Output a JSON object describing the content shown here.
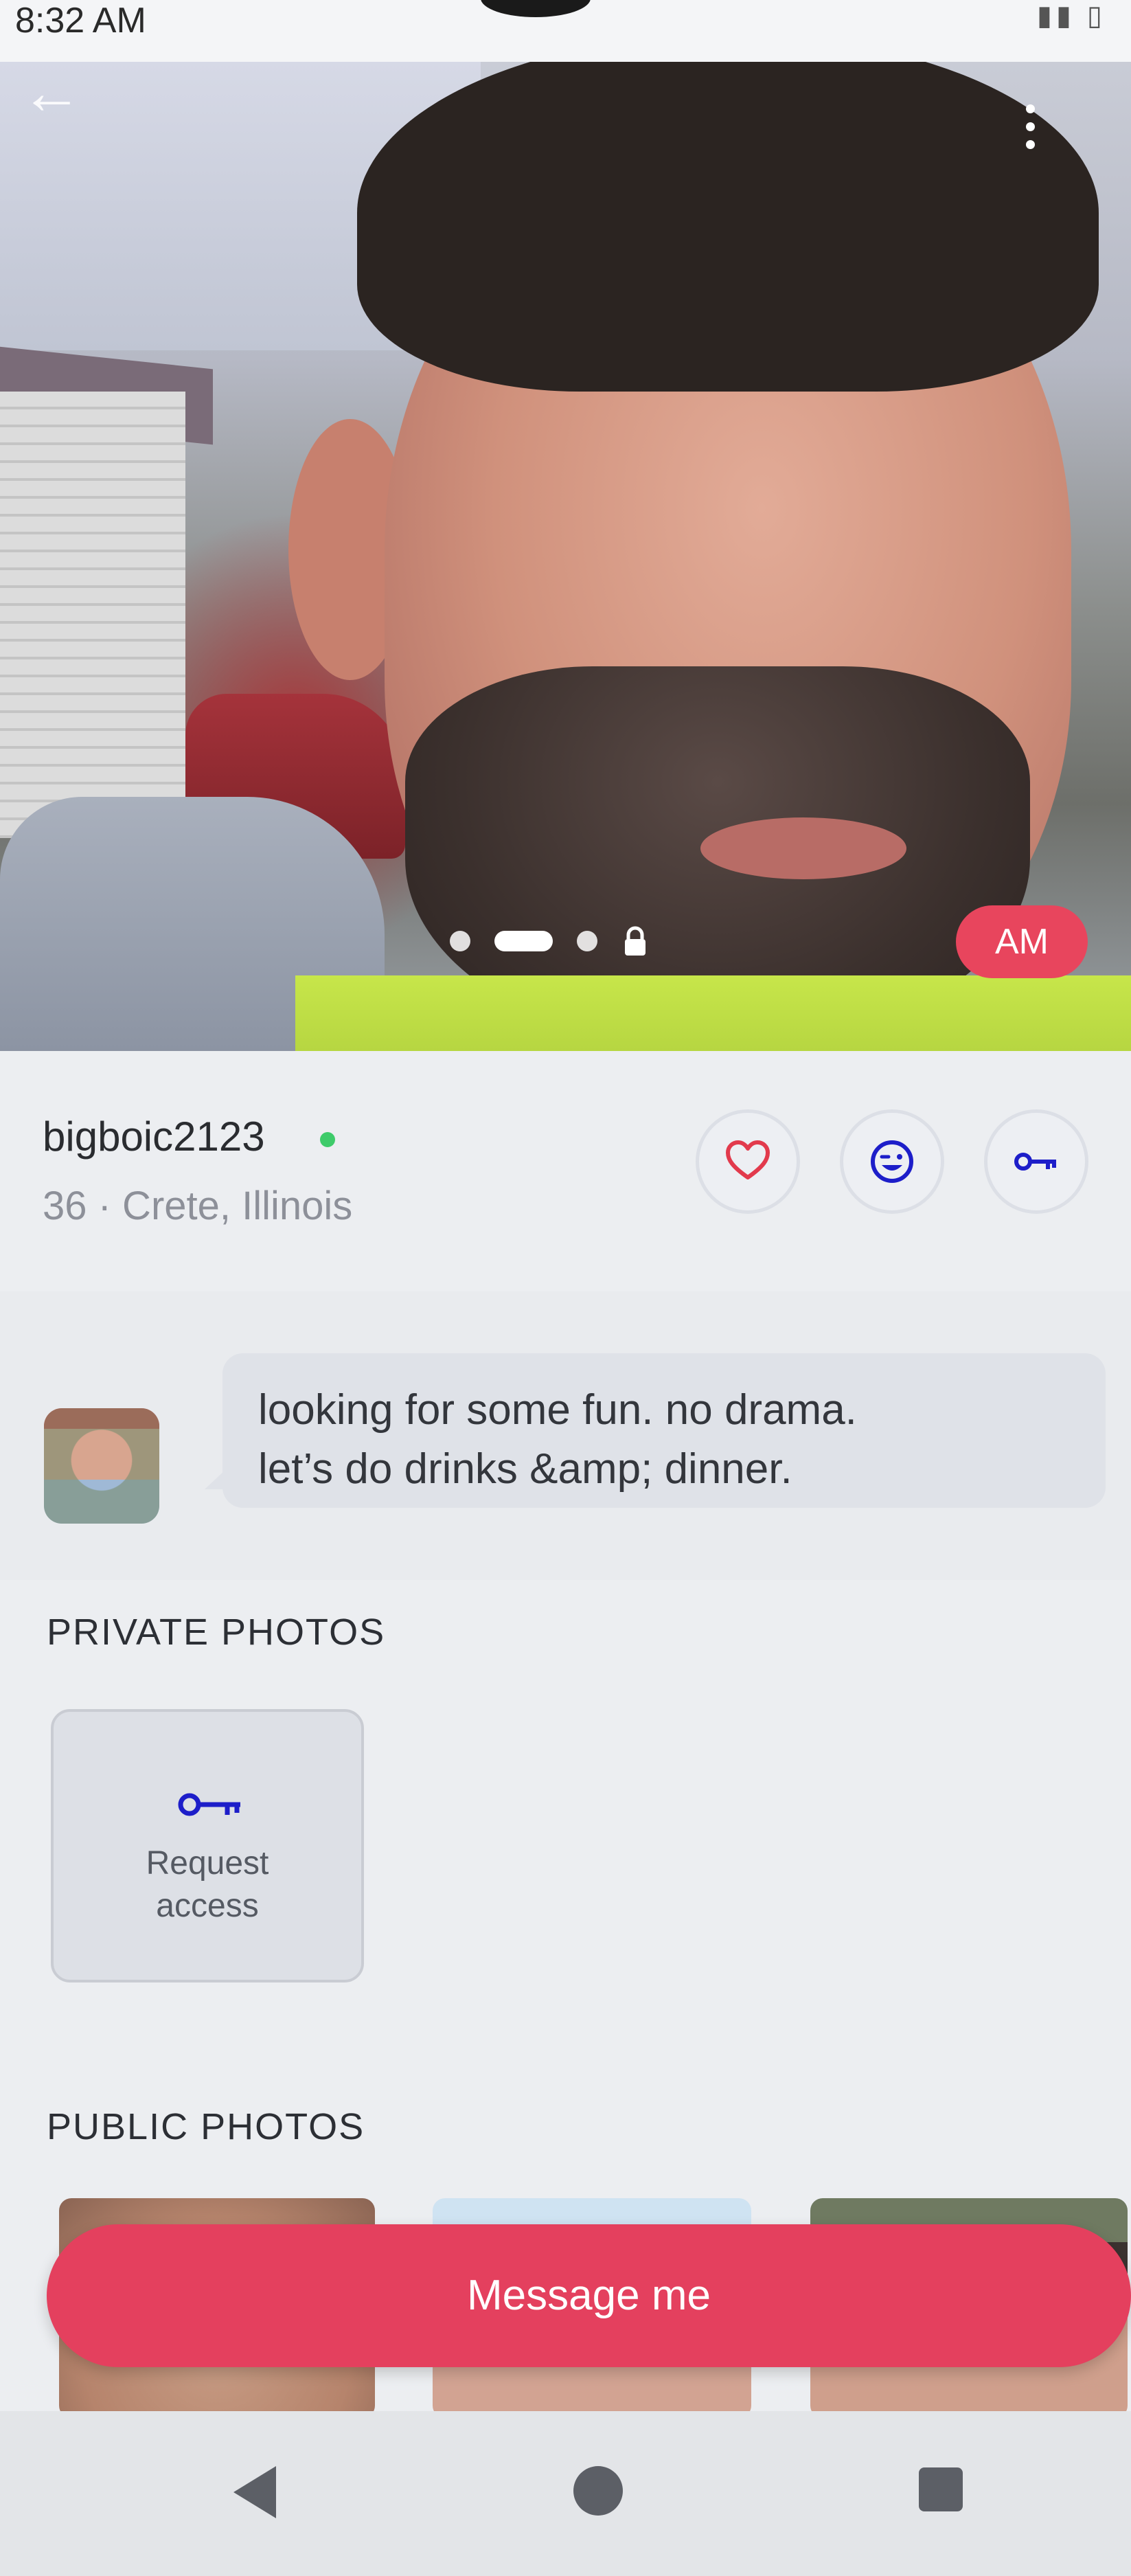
{
  "status_bar": {
    "time": "8:32 AM"
  },
  "hero": {
    "photo_alt": "profile photo",
    "badge": "AM",
    "pager": {
      "count": 4,
      "active_index": 1,
      "last_locked": true
    }
  },
  "profile": {
    "username": "bigboic2123",
    "online": true,
    "age_location": "36 · Crete, Illinois",
    "actions": [
      {
        "name": "like",
        "icon": "heart-icon"
      },
      {
        "name": "wink",
        "icon": "wink-face-icon"
      },
      {
        "name": "request-key",
        "icon": "key-icon"
      }
    ]
  },
  "bio": {
    "text_line1": "looking for some fun. no drama.",
    "text_line2": "let’s do drinks &amp; dinner."
  },
  "private_photos": {
    "title": "PRIVATE PHOTOS",
    "request_line1": "Request",
    "request_line2": "access"
  },
  "public_photos": {
    "title": "PUBLIC PHOTOS"
  },
  "cta": {
    "message_label": "Message me"
  },
  "colors": {
    "accent": "#e4405e",
    "online": "#3ecb6a",
    "heart": "#e23a4c",
    "icon_blue": "#1d1ec9"
  }
}
